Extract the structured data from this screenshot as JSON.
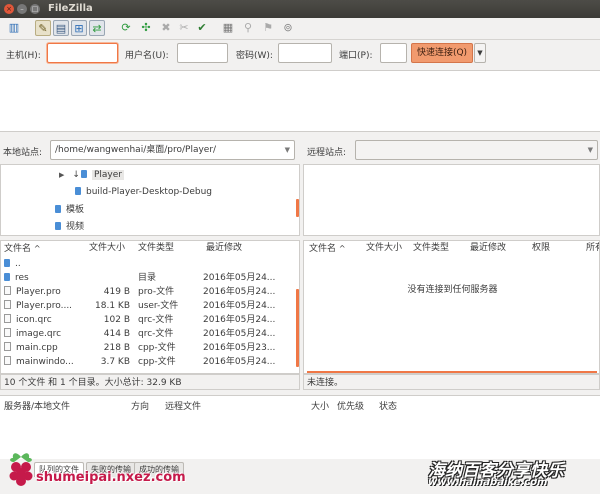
{
  "window": {
    "title": "FileZilla"
  },
  "toolbar": {
    "icons": [
      "site-manager-icon",
      "toggle-log-icon",
      "toggle-tree-icon",
      "toggle-remote-tree-icon",
      "toggle-queue-icon",
      "refresh-icon",
      "process-queue-icon",
      "cancel-icon",
      "disconnect-icon",
      "reconnect-icon",
      "filter-icon",
      "compare-icon",
      "sync-browse-icon",
      "search-icon"
    ]
  },
  "quickconnect": {
    "host_label": "主机(H):",
    "user_label": "用户名(U):",
    "pass_label": "密码(W):",
    "port_label": "端口(P):",
    "host_value": "",
    "user_value": "",
    "pass_value": "",
    "port_value": "",
    "connect_label": "快速连接(Q)"
  },
  "local": {
    "site_label": "本地站点:",
    "path": "/home/wangwenhai/桌面/pro/Player/",
    "tree": [
      {
        "label": "Player",
        "indent": 3,
        "expander": "▶",
        "selected": true
      },
      {
        "label": "build-Player-Desktop-Debug",
        "indent": 3,
        "expander": ""
      },
      {
        "label": "模板",
        "indent": 2,
        "expander": ""
      },
      {
        "label": "视频",
        "indent": 2,
        "expander": ""
      }
    ],
    "headers": {
      "name": "文件名",
      "size": "文件大小",
      "type": "文件类型",
      "modified": "最近修改"
    },
    "files": [
      {
        "name": "..",
        "size": "",
        "type": "",
        "modified": "",
        "kind": "folder"
      },
      {
        "name": "res",
        "size": "",
        "type": "目录",
        "modified": "2016年05月24...",
        "kind": "folder"
      },
      {
        "name": "Player.pro",
        "size": "419 B",
        "type": "pro-文件",
        "modified": "2016年05月24...",
        "kind": "file"
      },
      {
        "name": "Player.pro....",
        "size": "18.1 KB",
        "type": "user-文件",
        "modified": "2016年05月24...",
        "kind": "file"
      },
      {
        "name": "icon.qrc",
        "size": "102 B",
        "type": "qrc-文件",
        "modified": "2016年05月24...",
        "kind": "file"
      },
      {
        "name": "image.qrc",
        "size": "414 B",
        "type": "qrc-文件",
        "modified": "2016年05月24...",
        "kind": "file"
      },
      {
        "name": "main.cpp",
        "size": "218 B",
        "type": "cpp-文件",
        "modified": "2016年05月23...",
        "kind": "file"
      },
      {
        "name": "mainwindo...",
        "size": "3.7 KB",
        "type": "cpp-文件",
        "modified": "2016年05月24...",
        "kind": "file"
      }
    ],
    "status": "10 个文件 和 1 个目录。大小总计: 32.9 KB"
  },
  "remote": {
    "site_label": "远程站点:",
    "path": "",
    "headers": {
      "name": "文件名",
      "size": "文件大小",
      "type": "文件类型",
      "modified": "最近修改",
      "perms": "权限",
      "owner": "所有"
    },
    "empty_message": "没有连接到任何服务器",
    "status": "未连接。"
  },
  "queue": {
    "headers": {
      "server": "服务器/本地文件",
      "direction": "方向",
      "remote": "远程文件",
      "size": "大小",
      "priority": "优先级",
      "status": "状态"
    }
  },
  "tabs": [
    {
      "label": "队列的文件"
    },
    {
      "label": "失败的传输"
    },
    {
      "label": "成功的传输"
    }
  ],
  "watermarks": {
    "left": "shumeipai.nxez.com",
    "right_main": "海纳百客分享快乐",
    "right_sub": "www.hainabaike.com"
  },
  "colors": {
    "accent": "#f07746",
    "connect_button": "#f19a6e",
    "folder": "#4a8ed6"
  }
}
